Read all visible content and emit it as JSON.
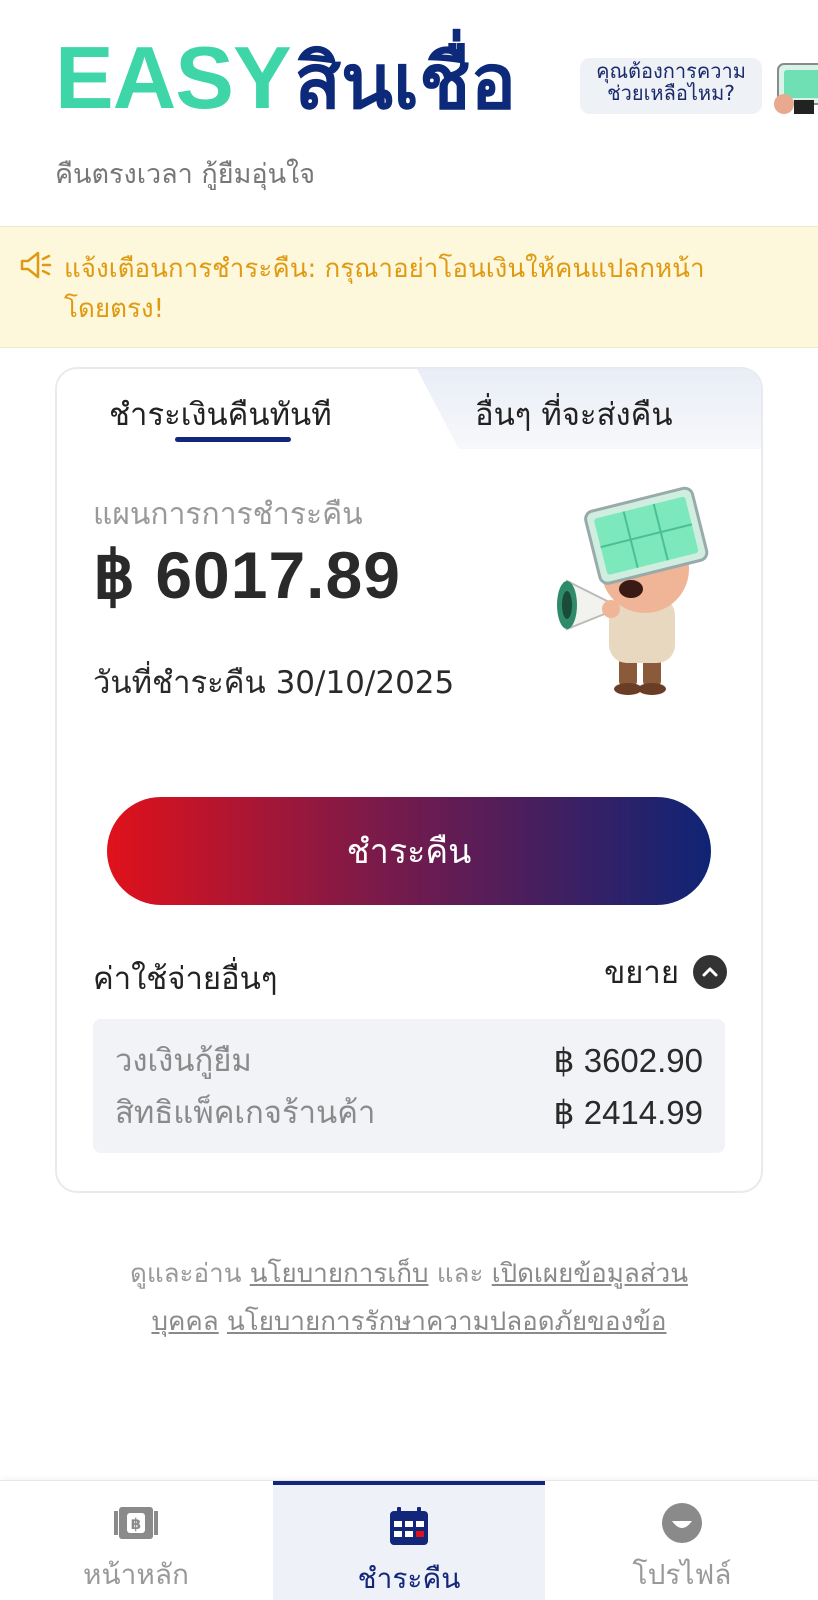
{
  "header": {
    "logo_latin": "EASY",
    "logo_thai": "สินเชื่อ",
    "tagline": "คืนตรงเวลา กู้ยืมอุ่นใจ",
    "help_bubble": "คุณต้องการความช่วยเหลือไหม?"
  },
  "alert": {
    "text": "แจ้งเตือนการชำระคืน: กรุณาอย่าโอนเงินให้คนแปลกหน้าโดยตรง!"
  },
  "card": {
    "tabs": [
      "ชำระเงินคืนทันที",
      "อื่นๆ ที่จะส่งคืน"
    ],
    "active_tab": 0,
    "plan_label": "แผนการการชำระคืน",
    "amount": "฿ 6017.89",
    "due_date": "วันที่ชำระคืน 30/10/2025",
    "pay_button": "ชำระคืน",
    "other_costs_label": "ค่าใช้จ่ายอื่นๆ",
    "expand_label": "ขยาย",
    "fees": [
      {
        "label": "วงเงินกู้ยืม",
        "value": "฿ 3602.90"
      },
      {
        "label": "สิทธิแพ็คเกจร้านค้า",
        "value": "฿ 2414.99"
      }
    ]
  },
  "policy": {
    "prefix": "ดูและอ่าน ",
    "link1": "นโยบายการเก็บ",
    "conj": " และ ",
    "link2": "เปิดเผยข้อมูลส่วนบุคคล",
    "space": " ",
    "link3": "นโยบายการรักษาความปลอดภัยของข้อ"
  },
  "bottom_nav": {
    "items": [
      {
        "label": "หน้าหลัก",
        "icon": "banknote-icon"
      },
      {
        "label": "ชำระคืน",
        "icon": "calendar-icon"
      },
      {
        "label": "โปรไฟล์",
        "icon": "profile-icon"
      }
    ],
    "active_index": 1
  },
  "colors": {
    "brand_green": "#3ed6a8",
    "brand_navy": "#0d2a7a",
    "alert_text": "#e09a12",
    "alert_bg": "#fdf7dc",
    "button_gradient_start": "#e0111b",
    "button_gradient_end": "#0f2475"
  }
}
